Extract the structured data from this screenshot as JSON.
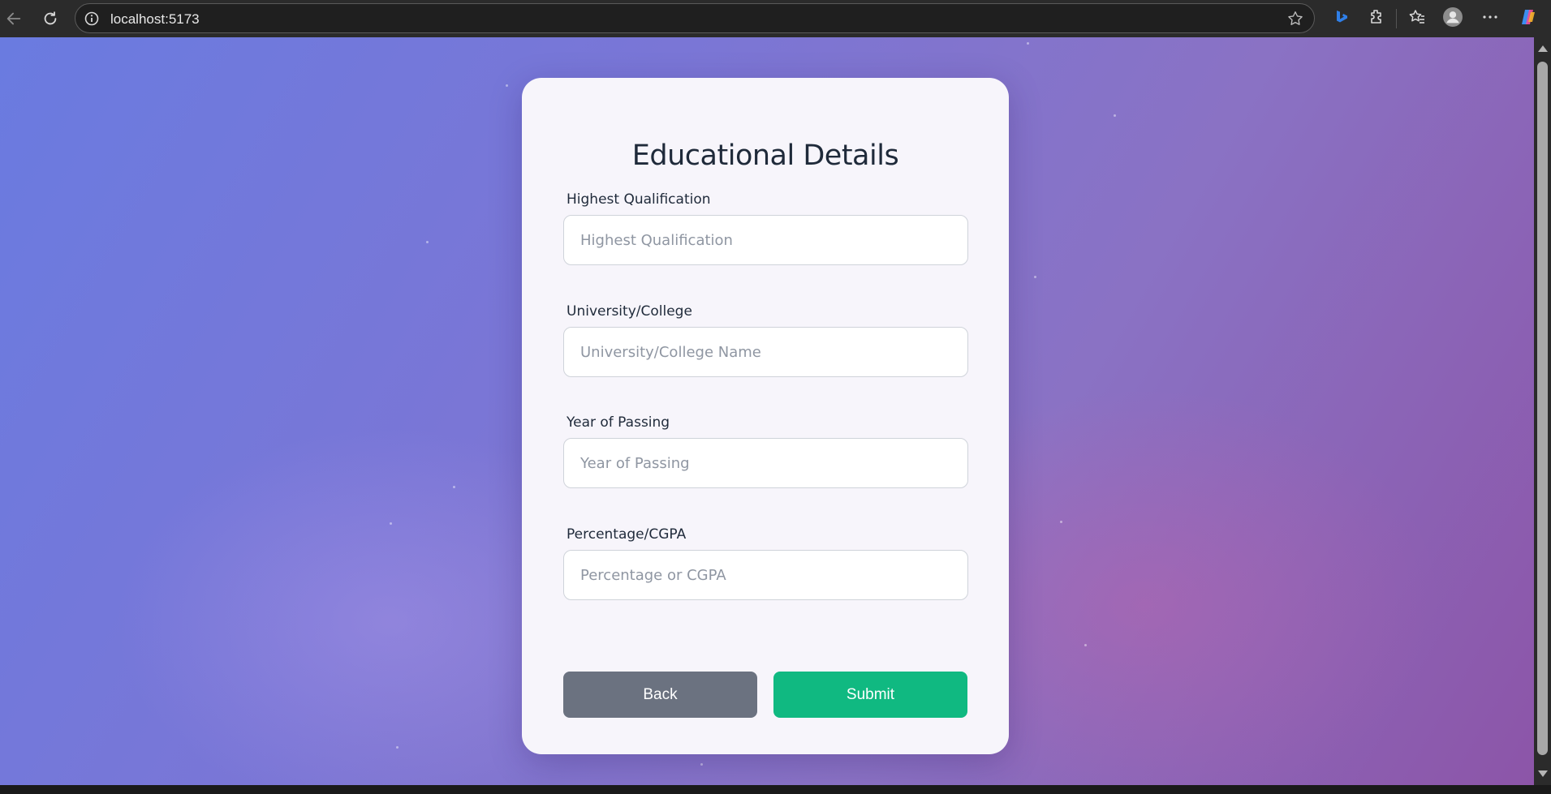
{
  "browser": {
    "url": "localhost:5173",
    "icons": [
      "back-arrow-icon",
      "reload-icon",
      "site-info-icon",
      "favorite-star-icon",
      "bing-icon",
      "extensions-icon",
      "favorites-icon",
      "profile-avatar-icon",
      "more-menu-icon",
      "copilot-icon"
    ]
  },
  "form": {
    "title": "Educational Details",
    "fields": [
      {
        "label": "Highest Qualification",
        "placeholder": "Highest Qualification",
        "value": ""
      },
      {
        "label": "University/College",
        "placeholder": "University/College Name",
        "value": ""
      },
      {
        "label": "Year of Passing",
        "placeholder": "Year of Passing",
        "value": ""
      },
      {
        "label": "Percentage/CGPA",
        "placeholder": "Percentage or CGPA",
        "value": ""
      }
    ],
    "back_label": "Back",
    "submit_label": "Submit"
  },
  "colors": {
    "back_button": "#6b7280",
    "submit_button": "#10b981",
    "card_background": "#f7f5fb",
    "title_text": "#1f2a3a"
  }
}
